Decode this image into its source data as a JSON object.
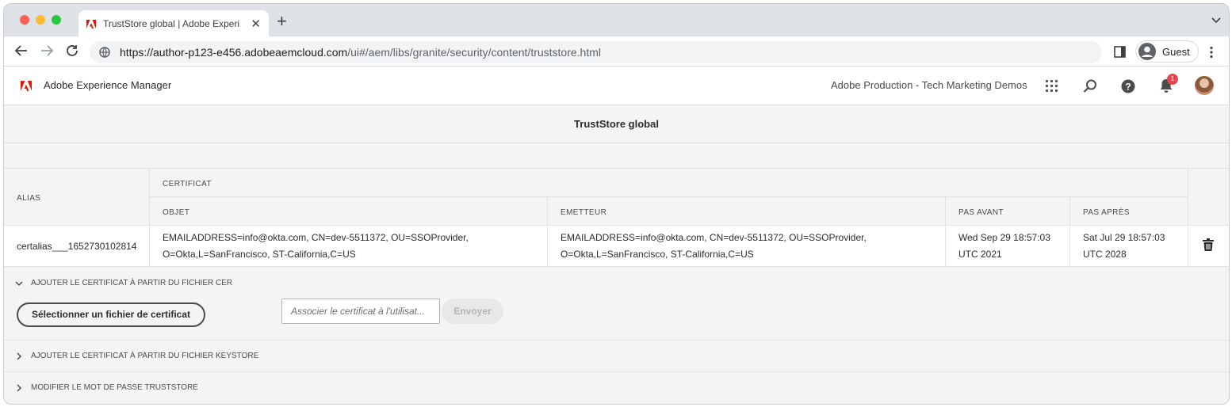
{
  "browser": {
    "tab_title": "TrustStore global | Adobe Experi",
    "url_host": "https://author-p123-e456.adobeaemcloud.com",
    "url_path": "/ui#/aem/libs/granite/security/content/truststore.html",
    "profile_label": "Guest"
  },
  "aem_header": {
    "brand": "Adobe Experience Manager",
    "org": "Adobe Production - Tech Marketing Demos",
    "notification_count": "1"
  },
  "page": {
    "title": "TrustStore global"
  },
  "table": {
    "col_alias": "ALIAS",
    "col_certificat": "CERTIFICAT",
    "col_objet": "OBJET",
    "col_emetteur": "EMETTEUR",
    "col_pas_avant": "PAS AVANT",
    "col_pas_apres": "PAS APRÈS",
    "rows": [
      {
        "alias": "certalias___1652730102814",
        "objet_line1": "EMAILADDRESS=info@okta.com, CN=dev-5511372, OU=SSOProvider,",
        "objet_line2": "O=Okta,L=SanFrancisco, ST-California,C=US",
        "emetteur_line1": "EMAILADDRESS=info@okta.com, CN=dev-5511372, OU=SSOProvider,",
        "emetteur_line2": "O=Okta,L=SanFrancisco, ST-California,C=US",
        "pas_avant_line1": "Wed Sep 29 18:57:03",
        "pas_avant_line2": "UTC 2021",
        "pas_apres_line1": "Sat Jul 29 18:57:03",
        "pas_apres_line2": "UTC 2028"
      }
    ]
  },
  "sections": {
    "cer": {
      "label": "AJOUTER LE CERTIFICAT À PARTIR DU FICHIER CER",
      "expanded": true,
      "select_button": "Sélectionner un fichier de certificat",
      "user_placeholder": "Associer le certificat à l'utilisat...",
      "send_button": "Envoyer"
    },
    "keystore": {
      "label": "AJOUTER LE CERTIFICAT À PARTIR DU FICHIER KEYSTORE",
      "expanded": false
    },
    "password": {
      "label": "MODIFIER LE MOT DE PASSE TRUSTSTORE",
      "expanded": false
    }
  },
  "colors": {
    "accent_red": "#e34850",
    "adobe_red": "#eb1000"
  }
}
